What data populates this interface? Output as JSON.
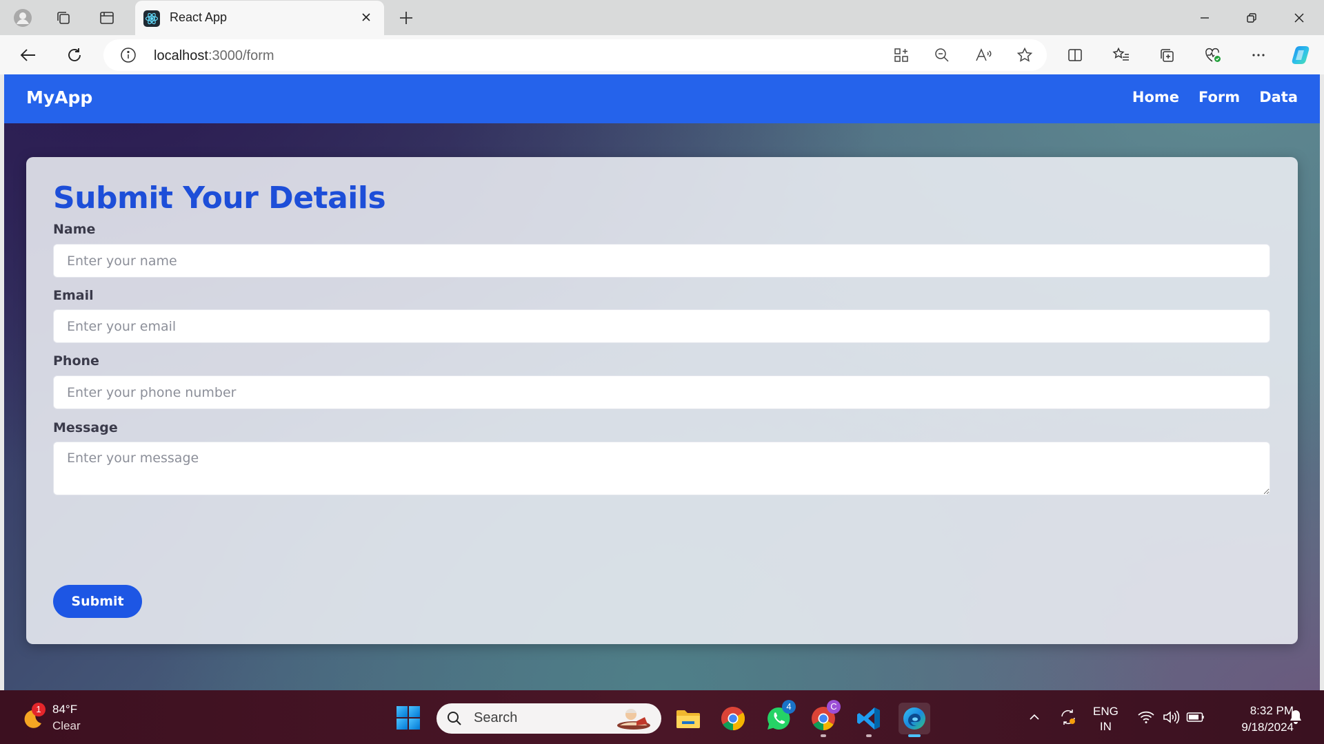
{
  "browser": {
    "tab": {
      "title": "React App",
      "favicon": "react-logo"
    },
    "address": {
      "host": "localhost",
      "path": ":3000/form"
    },
    "icons": {
      "tabstrip": [
        "profile-avatar-icon",
        "workspaces-icon",
        "tab-actions-icon",
        "new-tab-icon"
      ],
      "window": [
        "minimize-icon",
        "restore-icon",
        "close-window-icon"
      ],
      "toolbar": [
        "back-arrow-icon",
        "refresh-icon",
        "site-info-icon",
        "app-available-icon",
        "zoom-out-icon",
        "read-aloud-icon",
        "favorite-star-icon",
        "split-screen-icon",
        "favorites-list-icon",
        "collections-icon",
        "browser-essentials-icon",
        "more-options-icon",
        "copilot-icon"
      ]
    }
  },
  "app": {
    "brand": "MyApp",
    "nav": [
      {
        "label": "Home"
      },
      {
        "label": "Form"
      },
      {
        "label": "Data"
      }
    ],
    "form": {
      "title": "Submit Your Details",
      "fields": {
        "name": {
          "label": "Name",
          "placeholder": "Enter your name",
          "value": ""
        },
        "email": {
          "label": "Email",
          "placeholder": "Enter your email",
          "value": ""
        },
        "phone": {
          "label": "Phone",
          "placeholder": "Enter your phone number",
          "value": ""
        },
        "message": {
          "label": "Message",
          "placeholder": "Enter your message",
          "value": ""
        }
      },
      "submit_label": "Submit"
    },
    "colors": {
      "accent": "#2563eb",
      "title": "#1d4ed8",
      "button": "#1d56e4"
    }
  },
  "taskbar": {
    "weather": {
      "temp": "84°F",
      "condition": "Clear",
      "badge": "1"
    },
    "search_label": "Search",
    "apps": [
      {
        "name": "file-explorer-icon"
      },
      {
        "name": "chrome-icon"
      },
      {
        "name": "whatsapp-icon",
        "badge": "4"
      },
      {
        "name": "chrome-profile-icon",
        "badge": "C"
      },
      {
        "name": "vscode-icon"
      },
      {
        "name": "edge-icon"
      }
    ],
    "tray": {
      "language_line1": "ENG",
      "language_line2": "IN",
      "time": "8:32 PM",
      "date": "9/18/2024"
    }
  }
}
